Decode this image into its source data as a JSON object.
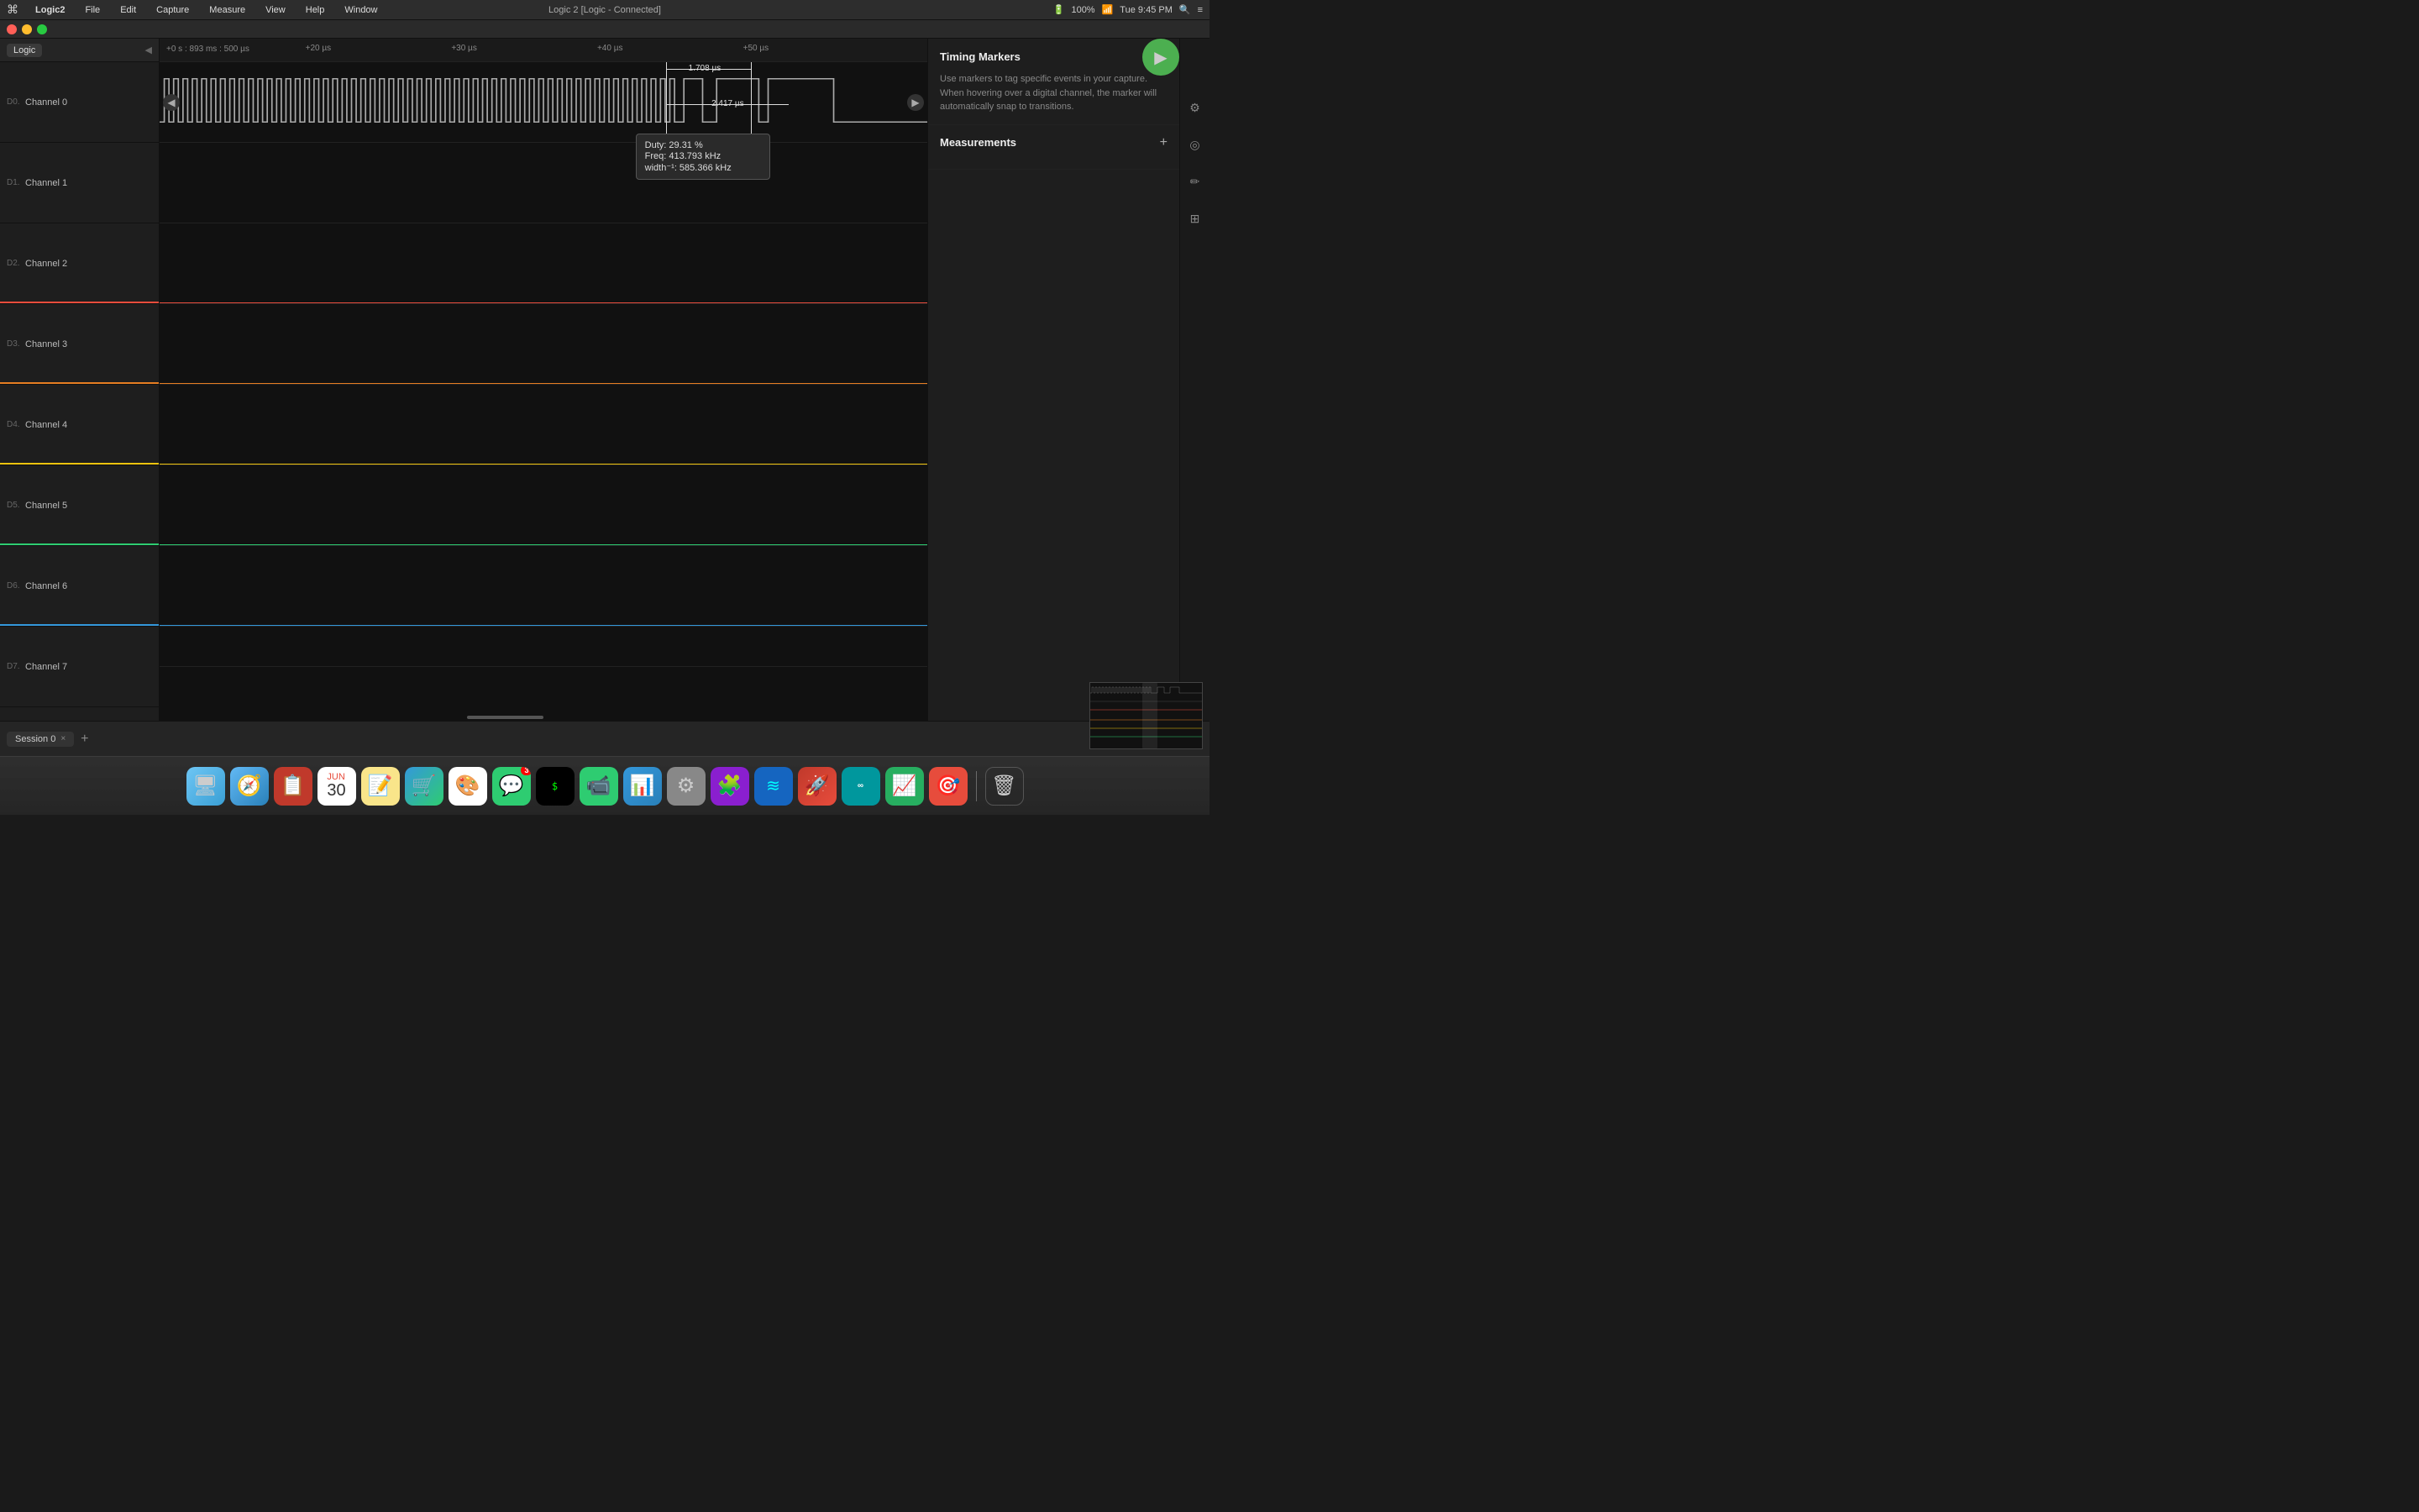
{
  "menubar": {
    "apple": "⌘",
    "items": [
      "Logic2",
      "File",
      "Edit",
      "Capture",
      "Measure",
      "View",
      "Help",
      "Window"
    ],
    "right": {
      "time": "Tue 9:45 PM",
      "battery": "100%",
      "wifi": "WiFi"
    },
    "window_title": "Logic 2 [Logic - Connected]"
  },
  "sidebar": {
    "badge": "Logic",
    "channels": [
      {
        "id": "D0.",
        "name": "Channel 0",
        "color": ""
      },
      {
        "id": "D1.",
        "name": "Channel 1",
        "color": ""
      },
      {
        "id": "D2.",
        "name": "Channel 2",
        "color": "#e74c3c"
      },
      {
        "id": "D3.",
        "name": "Channel 3",
        "color": "#e67e22"
      },
      {
        "id": "D4.",
        "name": "Channel 4",
        "color": "#f1c40f"
      },
      {
        "id": "D5.",
        "name": "Channel 5",
        "color": "#2ecc71"
      },
      {
        "id": "D6.",
        "name": "Channel 6",
        "color": "#3498db"
      },
      {
        "id": "D7.",
        "name": "Channel 7",
        "color": ""
      }
    ]
  },
  "timeline": {
    "offset_label": "+0 s : 893 ms : 500 µs",
    "time_markers": [
      {
        "label": "+20 µs",
        "pos_pct": 19
      },
      {
        "label": "+30 µs",
        "pos_pct": 38
      },
      {
        "label": "+40 µs",
        "pos_pct": 57
      },
      {
        "label": "+50 µs",
        "pos_pct": 76
      }
    ],
    "timing_1": "1.708 µs",
    "timing_2": "2.417 µs",
    "tooltip": {
      "duty": "Duty: 29.31 %",
      "freq": "Freq: 413.793 kHz",
      "width": "width⁻¹: 585.366 kHz"
    }
  },
  "right_panel": {
    "timing_markers": {
      "title": "Timing Markers",
      "description": "Use markers to tag specific events in your capture. When hovering over a digital channel, the marker will automatically snap to transitions."
    },
    "measurements": {
      "title": "Measurements"
    }
  },
  "bottom": {
    "session_label": "Session 0",
    "close_label": "×",
    "add_label": "+"
  },
  "dock_icons": [
    {
      "emoji": "🖥",
      "label": "Finder",
      "dot": true
    },
    {
      "emoji": "🧭",
      "label": "Safari",
      "dot": false
    },
    {
      "emoji": "📋",
      "label": "Contacts",
      "dot": false
    },
    {
      "emoji": "📅",
      "label": "Calendar",
      "dot": false
    },
    {
      "emoji": "📝",
      "label": "Notes",
      "dot": false
    },
    {
      "emoji": "🛒",
      "label": "App Store",
      "dot": false
    },
    {
      "emoji": "🎨",
      "label": "Photos",
      "dot": false
    },
    {
      "emoji": "💬",
      "label": "Messages",
      "badge": "3",
      "dot": true
    },
    {
      "emoji": "⌨",
      "label": "Terminal",
      "dot": false
    },
    {
      "emoji": "💬",
      "label": "FaceTime",
      "dot": false
    },
    {
      "emoji": "📊",
      "label": "Keynote",
      "dot": false
    },
    {
      "emoji": "⚙",
      "label": "System Prefs",
      "dot": false
    },
    {
      "emoji": "🧩",
      "label": "Visual Studio",
      "dot": false
    },
    {
      "emoji": "🔵",
      "label": "VS Code",
      "dot": false
    },
    {
      "emoji": "🚀",
      "label": "Launchpad",
      "dot": false
    },
    {
      "emoji": "🤖",
      "label": "Arduino",
      "dot": false
    },
    {
      "emoji": "📈",
      "label": "Finance",
      "dot": false
    },
    {
      "emoji": "🎯",
      "label": "Canister",
      "dot": false
    },
    {
      "emoji": "🗑",
      "label": "Trash",
      "dot": false
    }
  ]
}
